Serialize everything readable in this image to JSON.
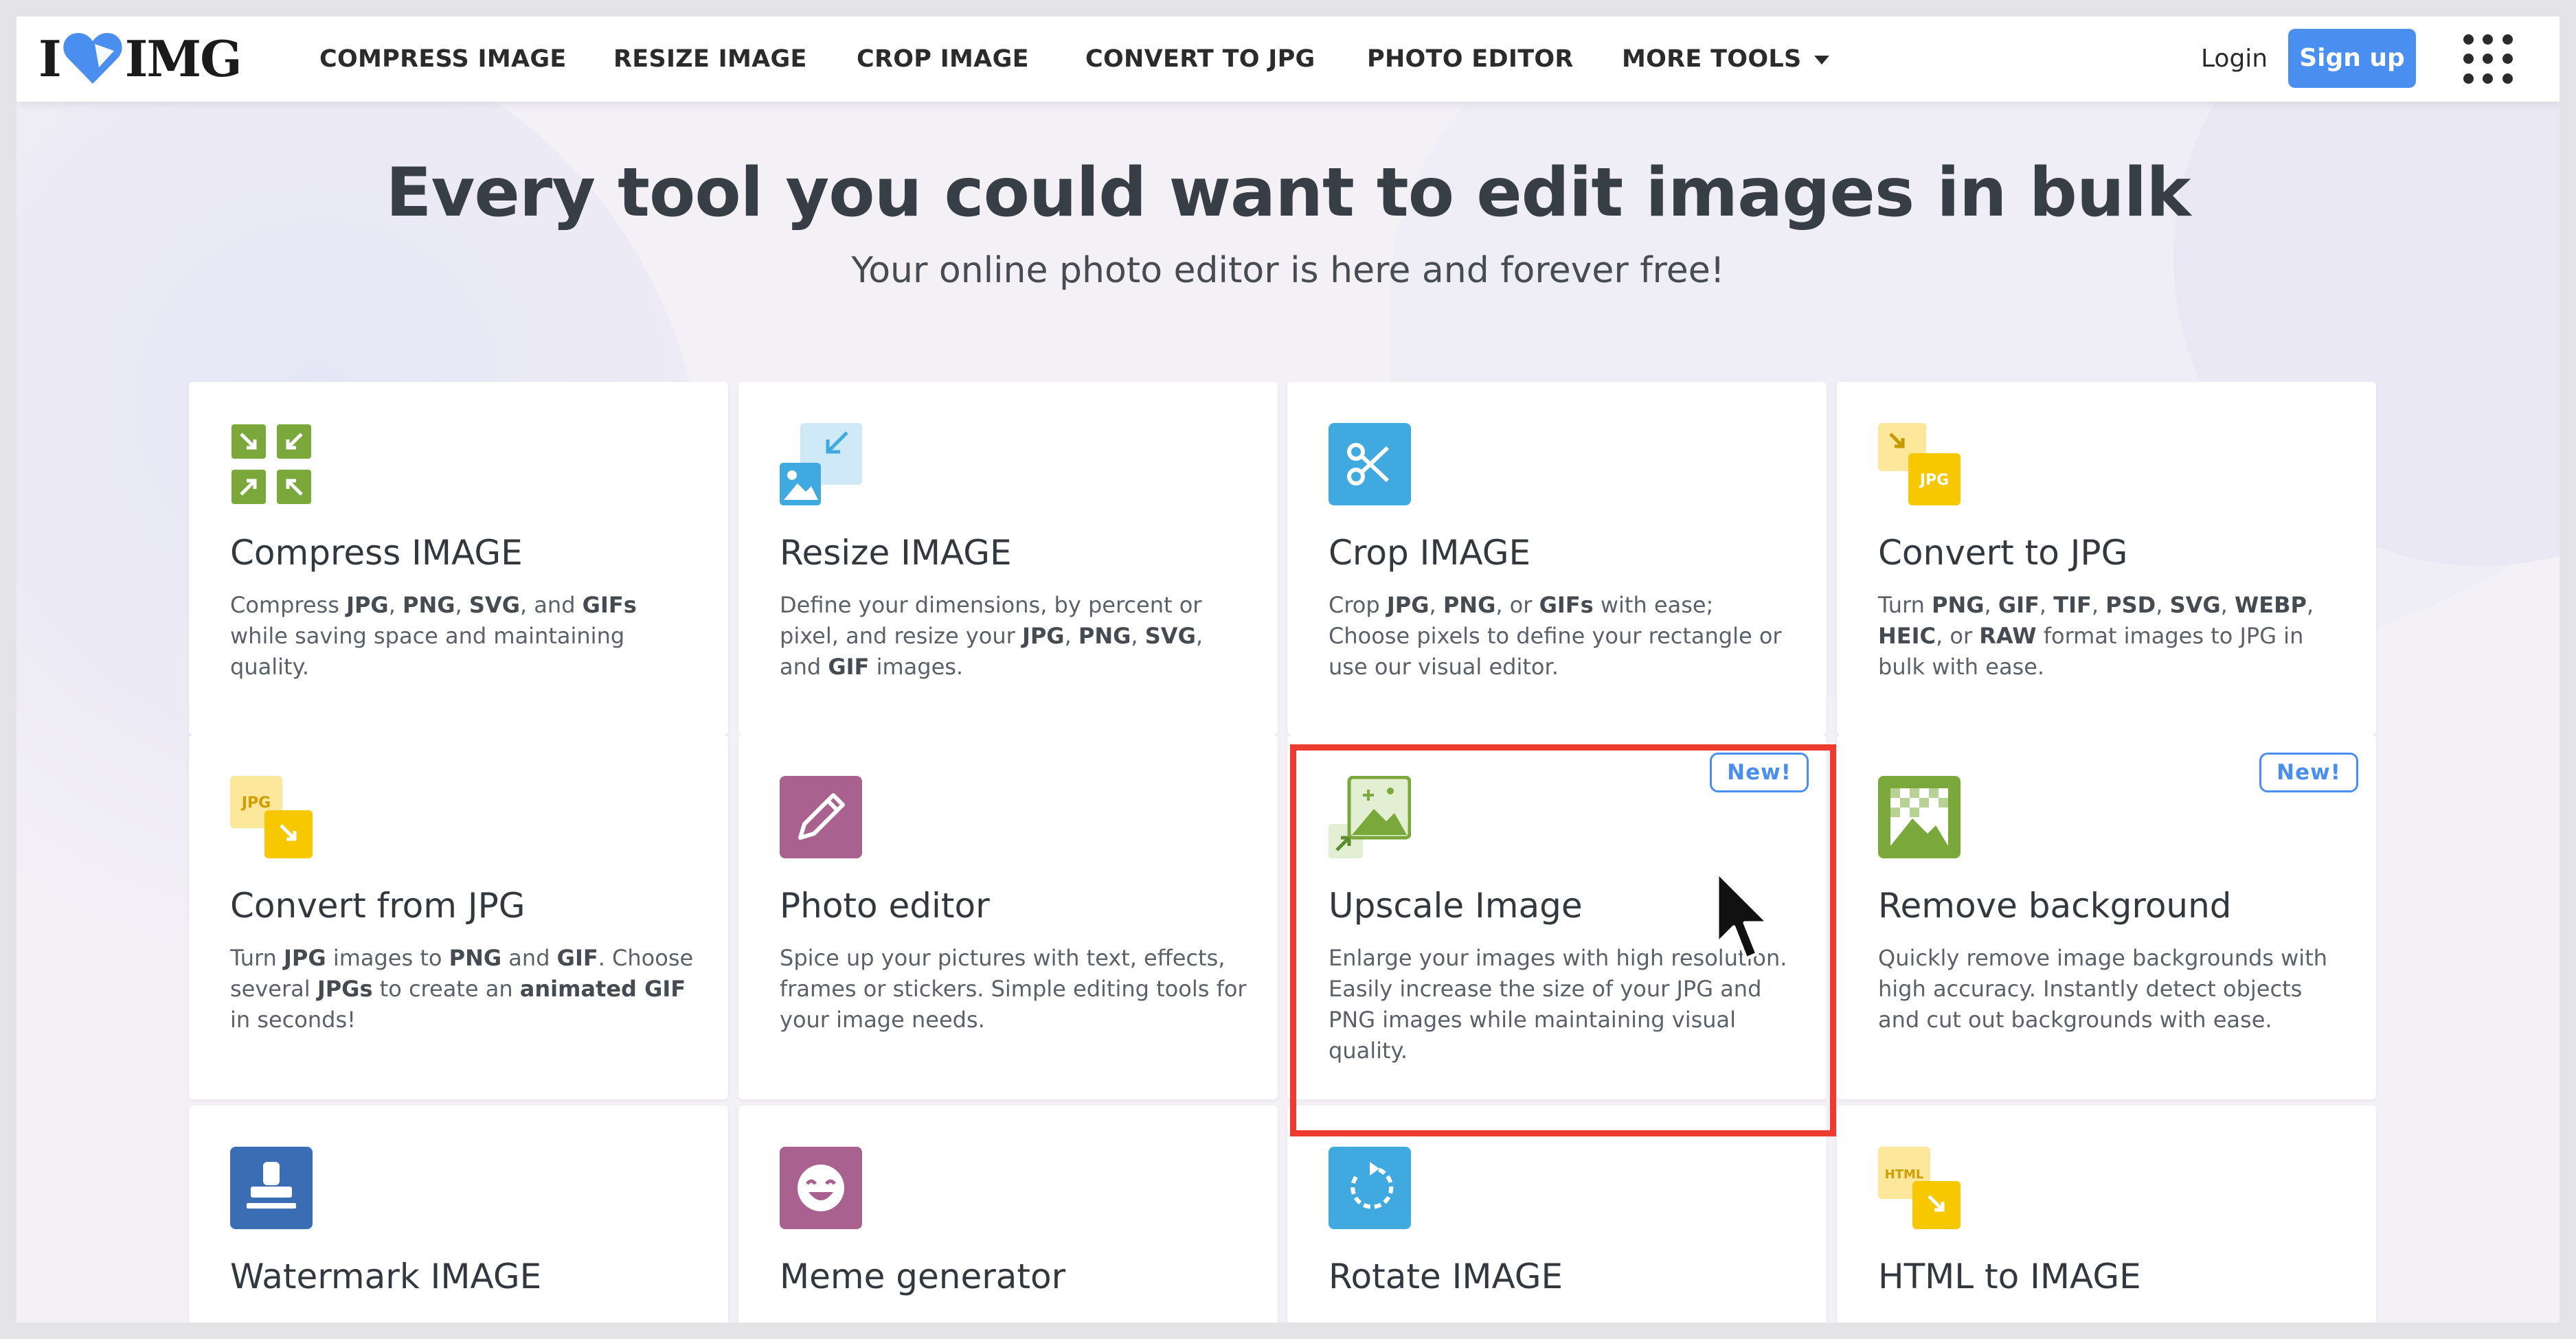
{
  "header": {
    "logo": {
      "left": "I",
      "right": "IMG"
    },
    "nav": [
      {
        "label": "COMPRESS IMAGE"
      },
      {
        "label": "RESIZE IMAGE"
      },
      {
        "label": "CROP IMAGE"
      },
      {
        "label": "CONVERT TO JPG"
      },
      {
        "label": "PHOTO EDITOR"
      },
      {
        "label": "MORE TOOLS"
      }
    ],
    "login": "Login",
    "signup": "Sign up"
  },
  "hero": {
    "title": "Every tool you could want to edit images in bulk",
    "subtitle": "Your online photo editor is here and forever free!"
  },
  "tools": [
    {
      "title": "Compress IMAGE",
      "icon": "compress-icon",
      "color": "#7ba83b",
      "desc": [
        [
          "t",
          "Compress "
        ],
        [
          "b",
          "JPG"
        ],
        [
          "t",
          ", "
        ],
        [
          "b",
          "PNG"
        ],
        [
          "t",
          ", "
        ],
        [
          "b",
          "SVG"
        ],
        [
          "t",
          ", and "
        ],
        [
          "b",
          "GIFs"
        ],
        [
          "t",
          " while saving space and maintaining quality."
        ]
      ]
    },
    {
      "title": "Resize IMAGE",
      "icon": "resize-icon",
      "color": "#3fa9e0",
      "desc": [
        [
          "t",
          "Define your dimensions, by percent or pixel, and resize your "
        ],
        [
          "b",
          "JPG"
        ],
        [
          "t",
          ", "
        ],
        [
          "b",
          "PNG"
        ],
        [
          "t",
          ", "
        ],
        [
          "b",
          "SVG"
        ],
        [
          "t",
          ", and "
        ],
        [
          "b",
          "GIF"
        ],
        [
          "t",
          " images."
        ]
      ]
    },
    {
      "title": "Crop IMAGE",
      "icon": "scissors-icon",
      "color": "#3fa9e0",
      "desc": [
        [
          "t",
          "Crop "
        ],
        [
          "b",
          "JPG"
        ],
        [
          "t",
          ", "
        ],
        [
          "b",
          "PNG"
        ],
        [
          "t",
          ", or "
        ],
        [
          "b",
          "GIFs"
        ],
        [
          "t",
          " with ease; Choose pixels to define your rectangle or use our visual editor."
        ]
      ]
    },
    {
      "title": "Convert to JPG",
      "icon": "convert-to-jpg-icon",
      "color": "#f7c700",
      "desc": [
        [
          "t",
          "Turn "
        ],
        [
          "b",
          "PNG"
        ],
        [
          "t",
          ", "
        ],
        [
          "b",
          "GIF"
        ],
        [
          "t",
          ", "
        ],
        [
          "b",
          "TIF"
        ],
        [
          "t",
          ", "
        ],
        [
          "b",
          "PSD"
        ],
        [
          "t",
          ", "
        ],
        [
          "b",
          "SVG"
        ],
        [
          "t",
          ", "
        ],
        [
          "b",
          "WEBP"
        ],
        [
          "t",
          ", "
        ],
        [
          "b",
          "HEIC"
        ],
        [
          "t",
          ", or "
        ],
        [
          "b",
          "RAW"
        ],
        [
          "t",
          " format images to JPG in bulk with ease."
        ]
      ]
    },
    {
      "title": "Convert from JPG",
      "icon": "convert-from-jpg-icon",
      "color": "#f7c700",
      "desc": [
        [
          "t",
          "Turn "
        ],
        [
          "b",
          "JPG"
        ],
        [
          "t",
          " images to "
        ],
        [
          "b",
          "PNG"
        ],
        [
          "t",
          " and "
        ],
        [
          "b",
          "GIF"
        ],
        [
          "t",
          ". Choose several "
        ],
        [
          "b",
          "JPGs"
        ],
        [
          "t",
          " to create an "
        ],
        [
          "b",
          "animated GIF"
        ],
        [
          "t",
          " in seconds!"
        ]
      ]
    },
    {
      "title": "Photo editor",
      "icon": "pencil-icon",
      "color": "#a9628f",
      "desc": [
        [
          "t",
          "Spice up your pictures with text, effects, frames or stickers. Simple editing tools for your image needs."
        ]
      ]
    },
    {
      "title": "Upscale Image",
      "icon": "upscale-icon",
      "color": "#7ba83b",
      "badge": "New!",
      "desc": [
        [
          "t",
          "Enlarge your images with high resolution. Easily increase the size of your JPG and PNG images while maintaining visual quality."
        ]
      ]
    },
    {
      "title": "Remove background",
      "icon": "remove-background-icon",
      "color": "#7ba83b",
      "badge": "New!",
      "desc": [
        [
          "t",
          "Quickly remove image backgrounds with high accuracy. Instantly detect objects and cut out backgrounds with ease."
        ]
      ]
    },
    {
      "title": "Watermark IMAGE",
      "icon": "stamp-icon",
      "color": "#3a6db3",
      "desc": []
    },
    {
      "title": "Meme generator",
      "icon": "meme-icon",
      "color": "#a9628f",
      "desc": []
    },
    {
      "title": "Rotate IMAGE",
      "icon": "rotate-icon",
      "color": "#3fa9e0",
      "desc": []
    },
    {
      "title": "HTML to IMAGE",
      "icon": "html-to-image-icon",
      "color": "#f7c700",
      "desc": []
    }
  ]
}
